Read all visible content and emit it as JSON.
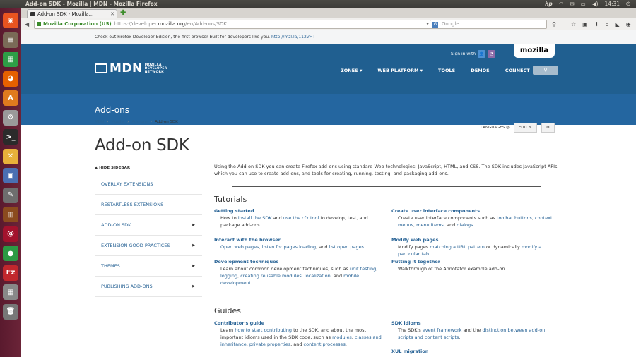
{
  "system": {
    "window_title": "Add-on SDK - Mozilla | MDN - Mozilla Firefox",
    "clock": "14:31",
    "tray_icons": [
      "hp-icon",
      "wifi-icon",
      "mail-icon",
      "battery-icon",
      "volume-icon",
      "clock",
      "power-icon"
    ]
  },
  "launcher": {
    "items": [
      {
        "name": "ubuntu-dash-icon",
        "color": "#e95420",
        "glyph": "◉"
      },
      {
        "name": "files-icon",
        "color": "#7a6a57",
        "glyph": "▤"
      },
      {
        "name": "libreoffice-calc-icon",
        "color": "#2e9e46",
        "glyph": "▦"
      },
      {
        "name": "firefox-icon",
        "color": "#e66000",
        "glyph": "◕"
      },
      {
        "name": "software-center-icon",
        "color": "#e07a1e",
        "glyph": "A"
      },
      {
        "name": "system-settings-icon",
        "color": "#9a9a9a",
        "glyph": "⚙"
      },
      {
        "name": "terminal-icon",
        "color": "#2b2b2b",
        "glyph": ">_"
      },
      {
        "name": "xchat-icon",
        "color": "#e8b13a",
        "glyph": "✕"
      },
      {
        "name": "image-viewer-icon",
        "color": "#4a6fb2",
        "glyph": "▣"
      },
      {
        "name": "text-editor-icon",
        "color": "#6e6e6e",
        "glyph": "✎"
      },
      {
        "name": "library-icon",
        "color": "#8b4b1e",
        "glyph": "▥"
      },
      {
        "name": "debian-icon",
        "color": "#a3122d",
        "glyph": "@"
      },
      {
        "name": "chrome-icon",
        "color": "#2c9a44",
        "glyph": "●"
      },
      {
        "name": "filezilla-icon",
        "color": "#c1272d",
        "glyph": "Fz"
      },
      {
        "name": "calculator-icon",
        "color": "#888888",
        "glyph": "▦"
      },
      {
        "name": "trash-icon",
        "color": "#777777",
        "glyph": "🗑"
      }
    ]
  },
  "browser": {
    "tab_title": "Add-on SDK - Mozilla...",
    "url_identity": "Mozilla Corporation (US)",
    "url_prefix": "https://developer.",
    "url_domain": "mozilla.org",
    "url_path": "/en/Add-ons/SDK",
    "search_engine_glyph": "G",
    "search_placeholder": "Google"
  },
  "mdn": {
    "promo_text": "Check out Firefox Developer Edition, the first browser built for developers like you.",
    "promo_link": "http://mzl.la/112VHT",
    "signin_label": "Sign in with",
    "mozilla_logo_text": "mozilla",
    "logo_text": "MDN",
    "logo_subtitle_1": "MOZILLA",
    "logo_subtitle_2": "DEVELOPER",
    "logo_subtitle_3": "NETWORK",
    "nav": [
      "ZONES",
      "WEB PLATFORM",
      "TOOLS",
      "DEMOS",
      "CONNECT"
    ],
    "section_title": "Add-ons",
    "breadcrumb": [
      "MDN",
      "Mozilla",
      "Add-ons",
      "Add-on SDK"
    ],
    "languages_label": "LANGUAGES",
    "edit_label": "EDIT",
    "page_title": "Add-on SDK",
    "hide_sidebar": "HIDE SIDEBAR",
    "sidebar": [
      {
        "label": "OVERLAY EXTENSIONS",
        "arrow": false
      },
      {
        "label": "RESTARTLESS EXTENSIONS",
        "arrow": false
      },
      {
        "label": "ADD-ON SDK",
        "arrow": true
      },
      {
        "label": "EXTENSION GOOD PRACTICES",
        "arrow": true
      },
      {
        "label": "THEMES",
        "arrow": true
      },
      {
        "label": "PUBLISHING ADD-ONS",
        "arrow": true
      }
    ],
    "intro": "Using the Add-on SDK you can create Firefox add-ons using standard Web technologies: JavaScript, HTML, and CSS. The SDK includes JavaScript APIs which you can use to create add-ons, and tools for creating, running, testing, and packaging add-ons.",
    "tutorials_heading": "Tutorials",
    "guides_heading": "Guides",
    "tutorials": {
      "getting_started": {
        "title": "Getting started",
        "t1": "How to ",
        "l1": "install the SDK",
        "t2": " and ",
        "l2": "use the cfx tool",
        "t3": " to develop, test, and package add-ons."
      },
      "interact": {
        "title": "Interact with the browser",
        "l1": "Open web pages",
        "t1": ", ",
        "l2": "listen for pages loading",
        "t2": ", and ",
        "l3": "list open pages",
        "t3": "."
      },
      "dev_techniques": {
        "title": "Development techniques",
        "t1": "Learn about common development techniques, such as ",
        "l1": "unit testing",
        "t2": ", ",
        "l2": "logging",
        "t3": ", ",
        "l3": "creating reusable modules",
        "t4": ", ",
        "l4": "localization",
        "t5": ", and ",
        "l5": "mobile development",
        "t6": "."
      },
      "ui_components": {
        "title": "Create user interface components",
        "t1": "Create user interface components such as ",
        "l1": "toolbar buttons",
        "t2": ", ",
        "l2": "context menus",
        "t3": ", ",
        "l3": "menu items",
        "t4": ", and ",
        "l4": "dialogs",
        "t5": "."
      },
      "modify": {
        "title": "Modify web pages",
        "t1": "Modify pages ",
        "l1": "matching a URL pattern",
        "t2": " or dynamically ",
        "l2": "modify a particular tab",
        "t3": "."
      },
      "together": {
        "title": "Putting it together",
        "t1": "Walkthrough of the Annotator example add-on."
      }
    },
    "guides": {
      "contrib": {
        "title": "Contributor's guide",
        "t1": "Learn ",
        "l1": "how to start contributing",
        "t2": " to the SDK, and about the most important idioms used in the SDK code, such as ",
        "l2": "modules",
        "t3": ", ",
        "l3": "classes and inheritance",
        "t4": ", ",
        "l4": "private properties",
        "t5": ", and ",
        "l5": "content processes",
        "t6": "."
      },
      "idioms": {
        "title": "SDK idioms",
        "t1": "The SDK's ",
        "l1": "event framework",
        "t2": " and the ",
        "l2": "distinction between add-on scripts and content scripts",
        "t3": "."
      },
      "xul": {
        "title": "XUL migration"
      }
    }
  }
}
